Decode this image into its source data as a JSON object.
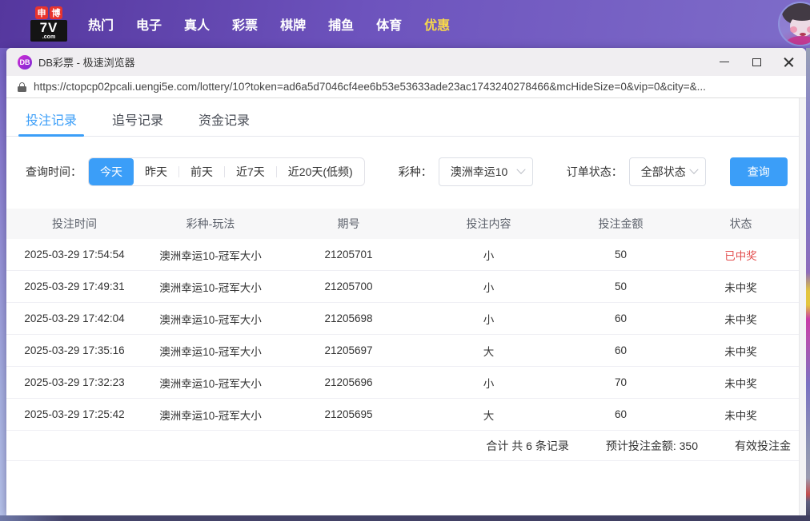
{
  "topbar": {
    "logo": {
      "badge1": "申",
      "badge2": "博",
      "main": "7V",
      "suffix": ".com"
    },
    "nav": [
      {
        "label": "热门"
      },
      {
        "label": "电子"
      },
      {
        "label": "真人"
      },
      {
        "label": "彩票"
      },
      {
        "label": "棋牌"
      },
      {
        "label": "捕鱼"
      },
      {
        "label": "体育"
      },
      {
        "label": "优惠",
        "highlight": true
      }
    ]
  },
  "window": {
    "icon_text": "DB",
    "title": "DB彩票 - 极速浏览器",
    "url": "https://ctopcp02pcali.uengi5e.com/lottery/10?token=ad6a5d7046cf4ee6b53e53633ade23ac1743240278466&mcHideSize=0&vip=0&city=&...",
    "icons": {
      "minimize": "css-line",
      "maximize": "css-square",
      "close": "css-x",
      "lock": "css-padlock",
      "chevron_down": "css-chevron"
    }
  },
  "tabs": [
    {
      "label": "投注记录",
      "active": true
    },
    {
      "label": "追号记录",
      "active": false
    },
    {
      "label": "资金记录",
      "active": false
    }
  ],
  "filters": {
    "time_label": "查询时间：",
    "time_options": [
      {
        "label": "今天",
        "active": true
      },
      {
        "label": "昨天",
        "active": false
      },
      {
        "label": "前天",
        "active": false
      },
      {
        "label": "近7天",
        "active": false
      },
      {
        "label": "近20天(低频)",
        "active": false
      }
    ],
    "lottery_label": "彩种：",
    "lottery_value": "澳洲幸运10",
    "status_label": "订单状态：",
    "status_value": "全部状态",
    "query_button": "查询"
  },
  "table": {
    "headers": [
      "投注时间",
      "彩种-玩法",
      "期号",
      "投注内容",
      "投注金额",
      "状态"
    ],
    "rows": [
      {
        "time": "2025-03-29 17:54:54",
        "game": "澳洲幸运10-冠军大小",
        "issue": "21205701",
        "content": "小",
        "amount": "50",
        "status": "已中奖",
        "won": true
      },
      {
        "time": "2025-03-29 17:49:31",
        "game": "澳洲幸运10-冠军大小",
        "issue": "21205700",
        "content": "小",
        "amount": "50",
        "status": "未中奖",
        "won": false
      },
      {
        "time": "2025-03-29 17:42:04",
        "game": "澳洲幸运10-冠军大小",
        "issue": "21205698",
        "content": "小",
        "amount": "60",
        "status": "未中奖",
        "won": false
      },
      {
        "time": "2025-03-29 17:35:16",
        "game": "澳洲幸运10-冠军大小",
        "issue": "21205697",
        "content": "大",
        "amount": "60",
        "status": "未中奖",
        "won": false
      },
      {
        "time": "2025-03-29 17:32:23",
        "game": "澳洲幸运10-冠军大小",
        "issue": "21205696",
        "content": "小",
        "amount": "70",
        "status": "未中奖",
        "won": false
      },
      {
        "time": "2025-03-29 17:25:42",
        "game": "澳洲幸运10-冠军大小",
        "issue": "21205695",
        "content": "大",
        "amount": "60",
        "status": "未中奖",
        "won": false
      }
    ],
    "summary": {
      "total": "合计 共 6 条记录",
      "expected": "预计投注金额: 350",
      "valid": "有效投注金"
    }
  },
  "colors": {
    "accent": "#3b9ef8",
    "win_status": "#e34f4f",
    "topbar_purple": "#6d53bd",
    "nav_highlight": "#f7d84b",
    "logo_red": "#e8342e"
  }
}
